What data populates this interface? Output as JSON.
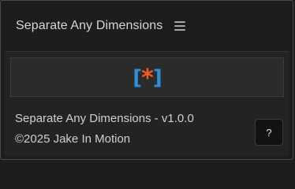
{
  "panel": {
    "title": "Separate Any Dimensions",
    "menu_icon": "hamburger-menu-icon"
  },
  "logo": {
    "bracket_open": "[",
    "star": "*",
    "bracket_close": "]",
    "colors": {
      "bracket": "#2f8ed8",
      "star": "#f05a23"
    }
  },
  "info": {
    "version": "Separate Any Dimensions - v1.0.0",
    "copyright": "©2025 Jake In Motion"
  },
  "help_button": {
    "label": "?"
  }
}
